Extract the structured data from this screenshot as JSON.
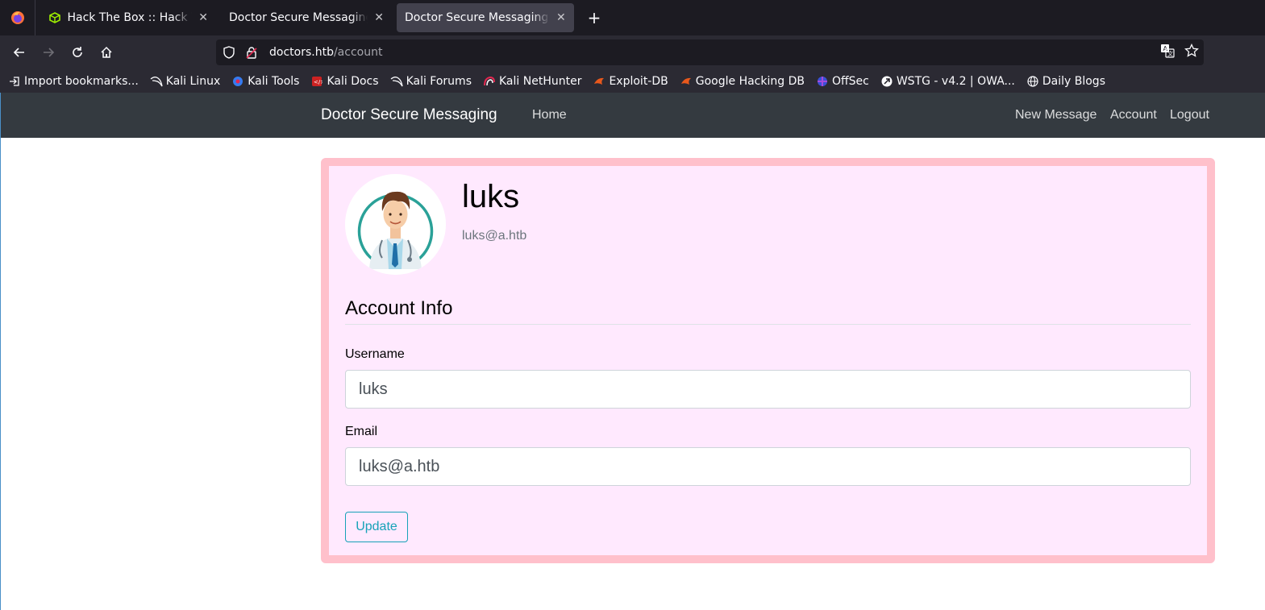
{
  "browser": {
    "tabs": [
      {
        "title": "Hack The Box :: Hack The",
        "icon": "htb-cube-icon",
        "active": false
      },
      {
        "title": "Doctor Secure Messaging - A",
        "icon": "none",
        "active": false
      },
      {
        "title": "Doctor Secure Messaging - A",
        "icon": "none",
        "active": true
      }
    ],
    "new_tab_label": "+",
    "url_host": "doctors.htb",
    "url_path": "/account",
    "bookmarks": [
      {
        "label": "Import bookmarks...",
        "icon": "import-icon"
      },
      {
        "label": "Kali Linux",
        "icon": "kali-dragon-icon"
      },
      {
        "label": "Kali Tools",
        "icon": "kali-tools-icon"
      },
      {
        "label": "Kali Docs",
        "icon": "kali-docs-icon"
      },
      {
        "label": "Kali Forums",
        "icon": "kali-dragon-icon"
      },
      {
        "label": "Kali NetHunter",
        "icon": "nethunter-icon"
      },
      {
        "label": "Exploit-DB",
        "icon": "exploit-db-icon"
      },
      {
        "label": "Google Hacking DB",
        "icon": "ghdb-icon"
      },
      {
        "label": "OffSec",
        "icon": "offsec-icon"
      },
      {
        "label": "WSTG - v4.2 | OWA...",
        "icon": "owasp-icon"
      },
      {
        "label": "Daily Blogs",
        "icon": "globe-icon"
      }
    ]
  },
  "site": {
    "brand": "Doctor Secure Messaging",
    "nav": {
      "home": "Home",
      "new_message": "New Message",
      "account": "Account",
      "logout": "Logout"
    }
  },
  "profile": {
    "username": "luks",
    "email": "luks@a.htb"
  },
  "form": {
    "legend": "Account Info",
    "username_label": "Username",
    "username_value": "luks",
    "email_label": "Email",
    "email_value": "luks@a.htb",
    "submit_label": "Update"
  },
  "colors": {
    "navbar": "#343a40",
    "card_bg": "#ffe9fe",
    "card_border": "#ffc0cb",
    "button_outline": "#17a2b8"
  }
}
